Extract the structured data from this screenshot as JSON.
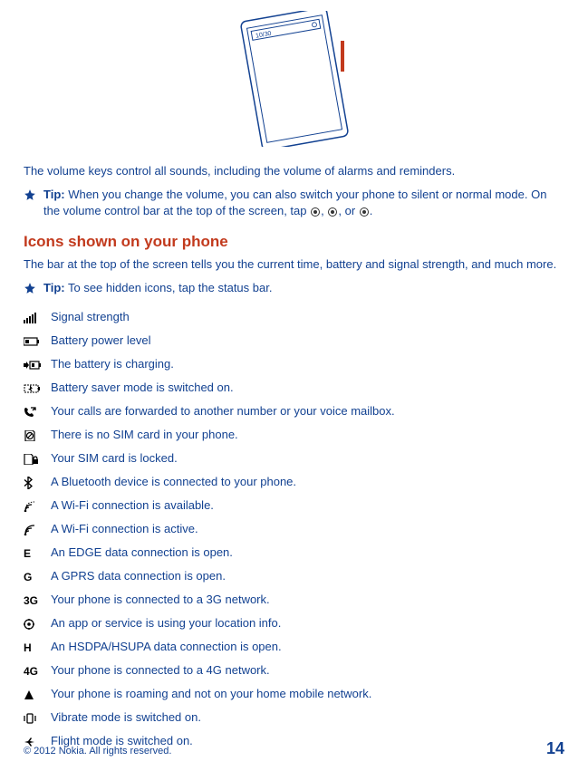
{
  "intro": "The volume keys control all sounds, including the volume of alarms and reminders.",
  "tip1": {
    "label": "Tip:",
    "text_before": " When you change the volume, you can also switch your phone to silent or normal mode. On the volume control bar at the top of the screen, tap ",
    "sep1": ", ",
    "sep2": ", or ",
    "text_after": "."
  },
  "section": {
    "heading": "Icons shown on your phone",
    "intro": "The bar at the top of the screen tells you the current time, battery and signal strength, and much more."
  },
  "tip2": {
    "label": "Tip:",
    "text": " To see hidden icons, tap the status bar."
  },
  "icons": [
    {
      "name": "signal-icon",
      "label": "Signal strength"
    },
    {
      "name": "battery-icon",
      "label": "Battery power level"
    },
    {
      "name": "battery-charging-icon",
      "label": "The battery is charging."
    },
    {
      "name": "battery-saver-icon",
      "label": "Battery saver mode is switched on."
    },
    {
      "name": "call-forward-icon",
      "label": "Your calls are forwarded to another number or your voice mailbox."
    },
    {
      "name": "no-sim-icon",
      "label": "There is no SIM card in your phone."
    },
    {
      "name": "sim-locked-icon",
      "label": "Your SIM card is locked."
    },
    {
      "name": "bluetooth-icon",
      "label": "A Bluetooth device is connected to your phone."
    },
    {
      "name": "wifi-available-icon",
      "label": "A Wi-Fi connection is available."
    },
    {
      "name": "wifi-active-icon",
      "label": "A Wi-Fi connection is active."
    },
    {
      "name": "edge-icon",
      "label": "An EDGE data connection is open."
    },
    {
      "name": "gprs-icon",
      "label": "A GPRS data connection is open."
    },
    {
      "name": "threeg-icon",
      "label": "Your phone is connected to a 3G network."
    },
    {
      "name": "location-icon",
      "label": "An app or service is using your location info."
    },
    {
      "name": "hsdpa-icon",
      "label": "An HSDPA/HSUPA data connection is open."
    },
    {
      "name": "fourg-icon",
      "label": "Your phone is connected to a 4G network."
    },
    {
      "name": "roaming-icon",
      "label": "Your phone is roaming and not on your home mobile network."
    },
    {
      "name": "vibrate-icon",
      "label": "Vibrate mode is switched on."
    },
    {
      "name": "flight-mode-icon",
      "label": "Flight mode is switched on."
    }
  ],
  "footer": {
    "copyright": "© 2012 Nokia. All rights reserved.",
    "page": "14"
  },
  "icon_text": {
    "edge": "E",
    "gprs": "G",
    "threeg": "3G",
    "hsdpa": "H",
    "fourg": "4G"
  }
}
